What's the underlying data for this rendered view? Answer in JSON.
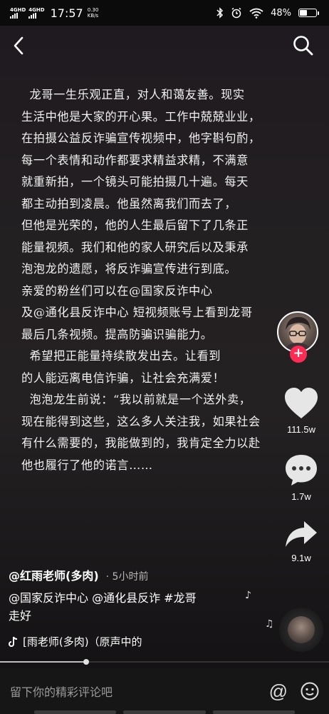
{
  "status": {
    "net1": "4G",
    "net1_sup": "HD",
    "net2": "4G",
    "net2_sup": "HD",
    "time": "17:57",
    "speed_value": "0.30",
    "speed_unit": "KB/s",
    "battery": "48%",
    "battery_level": 0.48
  },
  "story": {
    "lines": [
      "  龙哥一生乐观正直，对人和蔼友善。现实",
      "生活中他是大家的开心果。工作中兢兢业业，",
      "在拍摄公益反诈骗宣传视频中，他字斟句酌，",
      "每一个表情和动作都要求精益求精，不满意",
      "就重新拍，一个镜头可能拍摄几十遍。每天",
      "都主动拍到凌晨。他虽然离我们而去了，",
      "但他是光荣的，他的人生最后留下了几条正",
      "能量视频。我们和他的家人研究后以及秉承",
      "泡泡龙的遗愿，将反诈骗宣传进行到底。",
      "亲爱的粉丝们可以在@国家反诈中心",
      "及@通化县反诈中心 短视频账号上看到龙哥",
      "最后几条视频。提高防骗识骗能力。",
      "  希望把正能量持续散发出去。让看到",
      "的人能远离电信诈骗，让社会充满爱！",
      "  泡泡龙生前说：“我以前就是一个送外卖，",
      "现在能得到这些，这么多人关注我，如果社会",
      "有什么需要的，我能做到的，我肯定全力以赴",
      "他也履行了他的诺言……"
    ]
  },
  "rail": {
    "likes": "111.5w",
    "comments": "1.7w",
    "shares": "9.1w"
  },
  "post": {
    "author": "@红雨老师(多肉)",
    "separator": "·",
    "time_ago": "5小时前",
    "caption_line1": "@国家反诈中心 @通化县反诈  #龙哥",
    "caption_line2": "走好",
    "music": "[雨老师(多肉)（原声中的"
  },
  "playback_progress": 0.26,
  "comment_bar": {
    "placeholder": "留下你的精彩评论吧",
    "at_symbol": "@"
  },
  "colors": {
    "accent": "#fe2c55",
    "background": "#000000"
  }
}
